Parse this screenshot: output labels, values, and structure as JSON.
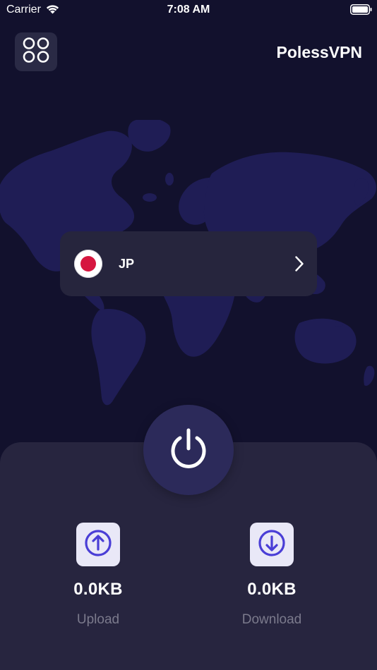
{
  "status_bar": {
    "carrier": "Carrier",
    "time": "7:08 AM"
  },
  "header": {
    "brand": "PolessVPN",
    "menu_icon": "grid-icon"
  },
  "server": {
    "country_code": "JP",
    "flag_icon": "japan-flag-icon"
  },
  "connection": {
    "power_icon": "power-icon"
  },
  "stats": {
    "upload": {
      "value": "0.0KB",
      "label": "Upload"
    },
    "download": {
      "value": "0.0KB",
      "label": "Download"
    }
  },
  "colors": {
    "background": "#12112d",
    "card": "#26253d",
    "panel": "#27253f",
    "power_button": "#2c2a5a",
    "accent": "#4a3ed6",
    "map": "#1f1d55"
  }
}
